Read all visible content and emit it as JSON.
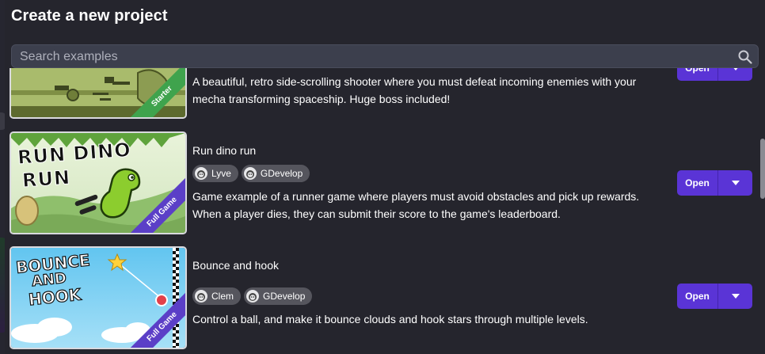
{
  "dialog": {
    "title": "Create a new project",
    "search": {
      "placeholder": "Search examples",
      "value": ""
    }
  },
  "examples": [
    {
      "title": "",
      "badge": "Starter",
      "description": "A beautiful, retro side-scrolling shooter where you must defeat incoming enemies with your mecha transforming spaceship. Huge boss included!",
      "authors": [],
      "open_label": "Open"
    },
    {
      "title": "Run dino run",
      "badge": "Full Game",
      "thumbnail_text": [
        "RUN DINO",
        "RUN"
      ],
      "description": "Game example of a runner game where players must avoid obstacles and pick up rewards. When a player dies, they can submit their score to the game's leaderboard.",
      "authors": [
        "Lyve",
        "GDevelop"
      ],
      "open_label": "Open"
    },
    {
      "title": "Bounce and hook",
      "badge": "Full Game",
      "thumbnail_text": [
        "BOUNCE",
        "AND",
        "HOOK"
      ],
      "description": "Control a ball, and make it bounce clouds and hook stars through multiple levels.",
      "authors": [
        "Clem",
        "GDevelop"
      ],
      "open_label": "Open"
    }
  ],
  "icons": {
    "search": "search-icon",
    "dropdown": "chevron-down-icon",
    "avatar": "user-avatar-icon"
  },
  "colors": {
    "background": "#25252d",
    "accent": "#5a34d6",
    "chip": "#55555d",
    "starter_badge": "#3fa34d",
    "full_game_badge": "#5b3fc7"
  }
}
